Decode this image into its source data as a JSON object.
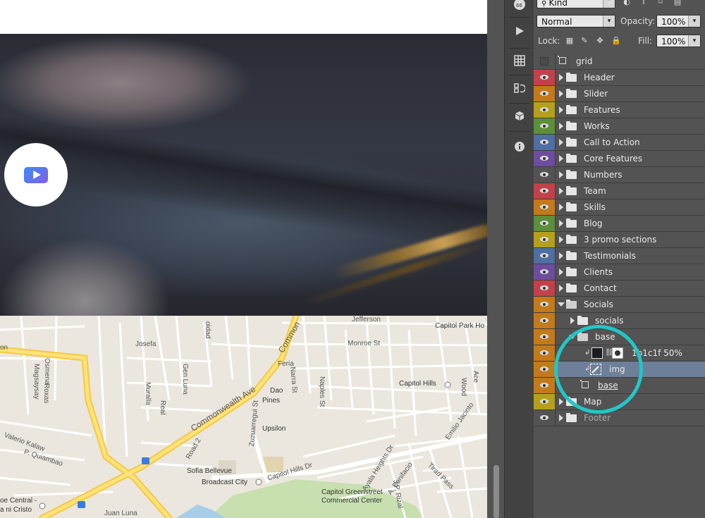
{
  "canvas": {
    "map": {
      "places": [
        "Capitol Park Ho",
        "Jefferson",
        "Monroe St",
        "Josefa",
        "Feria",
        "Narra St",
        "Gen Luna",
        "Muralla",
        "Real",
        "Dao",
        "Pines",
        "Naples St",
        "Capitol Hills",
        "Ace",
        "Wood",
        "Commonwealth Ave",
        "Common",
        "Upsilon",
        "Zuzuarregui St",
        "Road 2",
        "Sofia Bellevue",
        "Broadcast City",
        "Capitol Hills Dr",
        "Capitol Greenstreet",
        "Commercial Center",
        "Ayala Heights Dr",
        "A. Bonifacio",
        "J.P. Rizal",
        "Tirad Pass",
        "Emilio Jacinto",
        "Valerio Kalaw",
        "P. Quiambao",
        "Osmena",
        "Roxas",
        "Magsaysay",
        "oe Central -",
        "a ni Cristo",
        "Juan Luna",
        "oidad",
        "on"
      ]
    }
  },
  "toolbar": {
    "icons": [
      "cc-badge-icon",
      "play-icon",
      "grid-icon",
      "history-icon",
      "3d-cube-icon",
      "info-icon"
    ]
  },
  "panel": {
    "filter_kind": "Kind",
    "blend_mode": "Normal",
    "opacity_label": "Opacity:",
    "opacity_value": "100%",
    "lock_label": "Lock:",
    "fill_label": "Fill:",
    "fill_value": "100%",
    "layers": [
      {
        "name": "grid",
        "kind": "artboard",
        "visible": false,
        "color": "#535353"
      },
      {
        "name": "Header",
        "kind": "folder",
        "color": "#c3414b"
      },
      {
        "name": "Slider",
        "kind": "folder",
        "color": "#c27a1b"
      },
      {
        "name": "Features",
        "kind": "folder",
        "color": "#b5a01c"
      },
      {
        "name": "Works",
        "kind": "folder",
        "color": "#5d8e3a"
      },
      {
        "name": "Call to Action",
        "kind": "folder",
        "color": "#4f6ea1"
      },
      {
        "name": "Core Features",
        "kind": "folder",
        "color": "#6d4d9e"
      },
      {
        "name": "Numbers",
        "kind": "folder",
        "color": "#535353"
      },
      {
        "name": "Team",
        "kind": "folder",
        "color": "#c3414b"
      },
      {
        "name": "Skills",
        "kind": "folder",
        "color": "#c27a1b"
      },
      {
        "name": "Blog",
        "kind": "folder",
        "color": "#5d8e3a"
      },
      {
        "name": "3 promo sections",
        "kind": "folder",
        "color": "#b5a01c"
      },
      {
        "name": "Testimonials",
        "kind": "folder",
        "color": "#4f6ea1"
      },
      {
        "name": "Clients",
        "kind": "folder",
        "color": "#6d4d9e"
      },
      {
        "name": "Contact",
        "kind": "folder",
        "color": "#c3414b"
      },
      {
        "name": "Socials",
        "kind": "folder-open",
        "color": "#c27a1b"
      },
      {
        "name": "socials",
        "kind": "folder",
        "color": "#c27a1b"
      },
      {
        "name": "base",
        "kind": "folder-open",
        "color": "#c27a1b"
      },
      {
        "name": "1b1c1f 50%",
        "kind": "fill-layer",
        "color": "#c27a1b"
      },
      {
        "name": "img",
        "kind": "smart-layer",
        "color": "#c27a1b",
        "selected": true
      },
      {
        "name": "base",
        "kind": "artboard-layer",
        "color": "#c27a1b"
      },
      {
        "name": "Map",
        "kind": "folder",
        "color": "#b5a01c"
      },
      {
        "name": "Footer",
        "kind": "folder",
        "color": "#535353",
        "dim": true
      }
    ]
  }
}
